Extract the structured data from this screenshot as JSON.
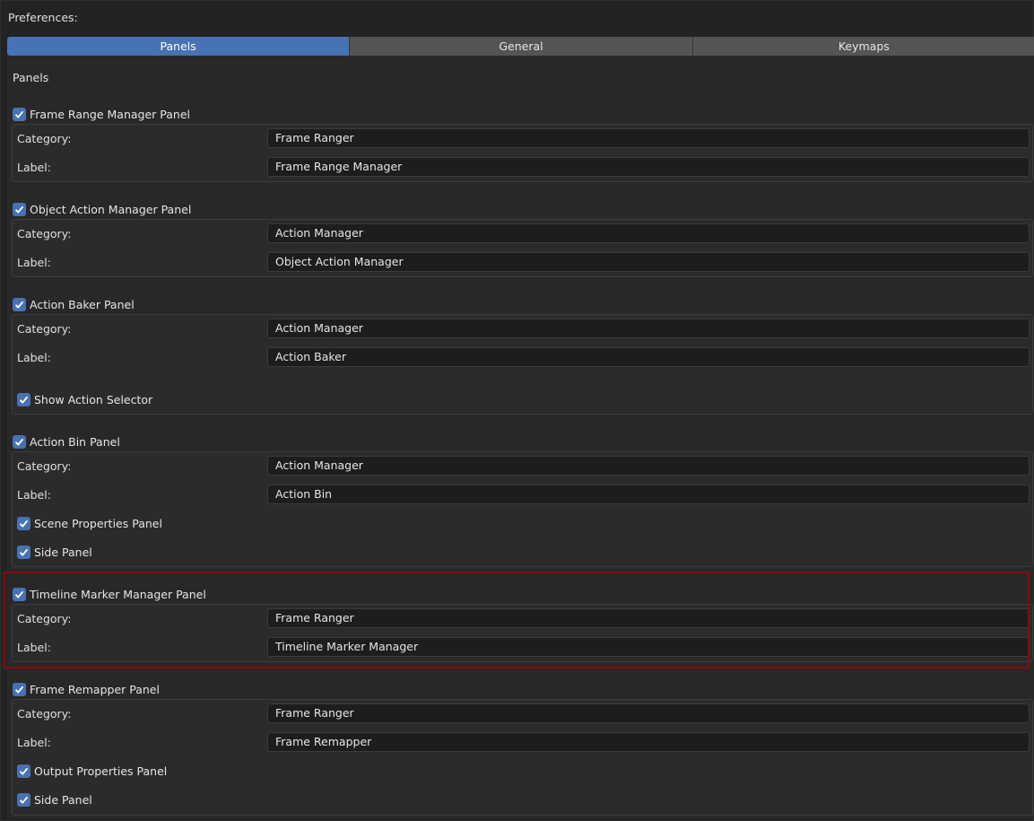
{
  "window": {
    "title": "Preferences:"
  },
  "tabs": [
    {
      "label": "Panels",
      "active": true
    },
    {
      "label": "General",
      "active": false
    },
    {
      "label": "Keymaps",
      "active": false
    }
  ],
  "section": {
    "label": "Panels"
  },
  "labels": {
    "category": "Category:",
    "label": "Label:"
  },
  "panels": [
    {
      "name": "Frame Range Manager Panel",
      "enabled": true,
      "category": "Frame Ranger",
      "label": "Frame Range Manager",
      "options": []
    },
    {
      "name": "Object Action Manager Panel",
      "enabled": true,
      "category": "Action Manager",
      "label": "Object Action Manager",
      "options": []
    },
    {
      "name": "Action Baker Panel",
      "enabled": true,
      "category": "Action Manager",
      "label": "Action Baker",
      "options": [
        {
          "label": "Show Action Selector",
          "checked": true
        }
      ]
    },
    {
      "name": "Action Bin Panel",
      "enabled": true,
      "category": "Action Manager",
      "label": "Action Bin",
      "options": [
        {
          "label": "Scene Properties Panel",
          "checked": true
        },
        {
          "label": "Side Panel",
          "checked": true
        }
      ]
    },
    {
      "name": "Timeline Marker Manager Panel",
      "enabled": true,
      "highlighted": true,
      "category": "Frame Ranger",
      "label": "Timeline Marker Manager",
      "options": []
    },
    {
      "name": "Frame Remapper Panel",
      "enabled": true,
      "category": "Frame Ranger",
      "label": "Frame Remapper",
      "options": [
        {
          "label": "Output Properties Panel",
          "checked": true
        },
        {
          "label": "Side Panel",
          "checked": true
        }
      ]
    }
  ],
  "colors": {
    "accent": "#4772b3",
    "highlight_border": "#8c0a0a",
    "background": "#282828",
    "field_background": "#1d1d1d"
  }
}
